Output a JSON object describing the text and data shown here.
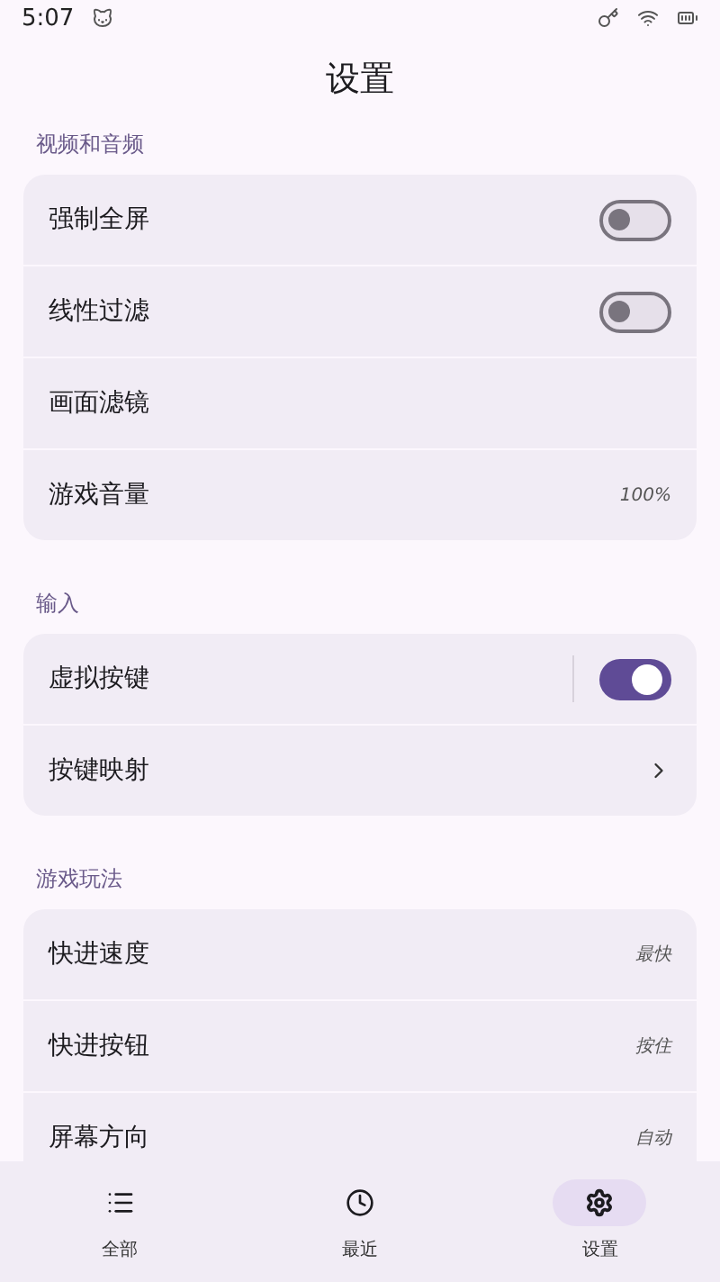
{
  "status_bar": {
    "time": "5:07"
  },
  "title": "设置",
  "sections": [
    {
      "header": "视频和音频",
      "items": [
        {
          "label": "强制全屏",
          "kind": "toggle",
          "on": false
        },
        {
          "label": "线性过滤",
          "kind": "toggle",
          "on": false
        },
        {
          "label": "画面滤镜",
          "kind": "plain"
        },
        {
          "label": "游戏音量",
          "kind": "value",
          "value": "100%"
        }
      ]
    },
    {
      "header": "输入",
      "items": [
        {
          "label": "虚拟按键",
          "kind": "split_toggle",
          "on": true
        },
        {
          "label": "按键映射",
          "kind": "chevron"
        }
      ]
    },
    {
      "header": "游戏玩法",
      "items": [
        {
          "label": "快进速度",
          "kind": "value",
          "value": "最快"
        },
        {
          "label": "快进按钮",
          "kind": "value",
          "value": "按住"
        },
        {
          "label": "屏幕方向",
          "kind": "value",
          "value": "自动"
        }
      ]
    }
  ],
  "nav": [
    {
      "label": "全部",
      "selected": false
    },
    {
      "label": "最近",
      "selected": false
    },
    {
      "label": "设置",
      "selected": true
    }
  ]
}
